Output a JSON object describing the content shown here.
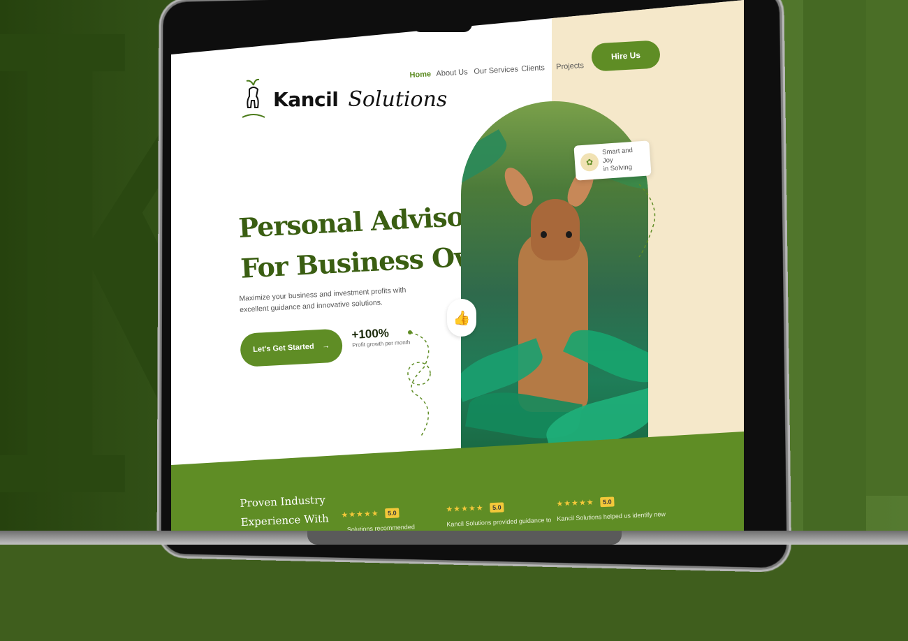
{
  "brand": {
    "name": "Kancil",
    "script": "Solutions"
  },
  "nav": {
    "items": [
      {
        "label": "Home",
        "active": true
      },
      {
        "label": "About Us",
        "active": false
      },
      {
        "label": "Our Services",
        "active": false
      },
      {
        "label": "Clients",
        "active": false
      },
      {
        "label": "Projects",
        "active": false
      }
    ],
    "hire_label": "Hire Us"
  },
  "hero": {
    "title_line1": "Personal Advisor",
    "title_line2": "For Business Owner",
    "subtitle": "Maximize your business and investment profits with excellent guidance and innovative solutions.",
    "cta_label": "Let's Get Started",
    "cta_arrow": "→",
    "stat_value": "+100%",
    "stat_label": "Profit growth per month"
  },
  "badge": {
    "line1": "Smart and Joy",
    "line2": "in Solving"
  },
  "testimonials": {
    "heading_line1": "Proven Industry",
    "heading_line2": "Experience With",
    "items": [
      {
        "stars": "★★★★★",
        "rating": "5.0",
        "text": "...Solutions recommended"
      },
      {
        "stars": "★★★★★",
        "rating": "5.0",
        "text": "Kancil Solutions provided guidance to"
      },
      {
        "stars": "★★★★★",
        "rating": "5.0",
        "text": "Kancil Solutions helped us identify new"
      }
    ]
  },
  "colors": {
    "brand_green": "#5f8d25",
    "cream": "#f5e8ca",
    "headline": "#3a5e12",
    "star": "#f3c83a"
  }
}
